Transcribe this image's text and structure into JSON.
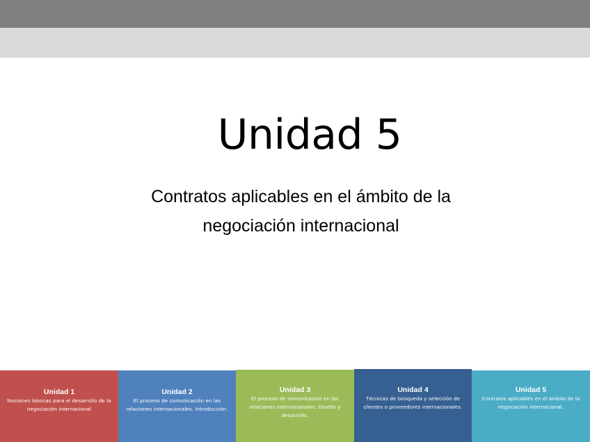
{
  "slide": {
    "title": "Unidad 5",
    "subtitle": "Contratos aplicables en el ámbito de la negociación internacional"
  },
  "colors": {
    "top_bar": "#7f7f7f",
    "sub_bar": "#d9d9d9",
    "unit_1": "#c0504d",
    "unit_2": "#4f81bd",
    "unit_3": "#9bbb59",
    "unit_4": "#366092",
    "unit_5": "#4bacc6"
  },
  "units": [
    {
      "title": "Unidad 1",
      "description": "Nociones básicas para el desarrollo de la negociación internacional"
    },
    {
      "title": "Unidad 2",
      "description": "El proceso de comunicación en las relaciones internacionales. Introducción."
    },
    {
      "title": "Unidad 3",
      "description": "El proceso de comunicación en las relaciones internacionales. Diseño y desarrollo."
    },
    {
      "title": "Unidad 4",
      "description": "Técnicas de búsqueda y selección de clientes o proveedores internacionales."
    },
    {
      "title": "Unidad 5",
      "description": "Contratos aplicables en el ámbito de la negociación internacional."
    }
  ]
}
